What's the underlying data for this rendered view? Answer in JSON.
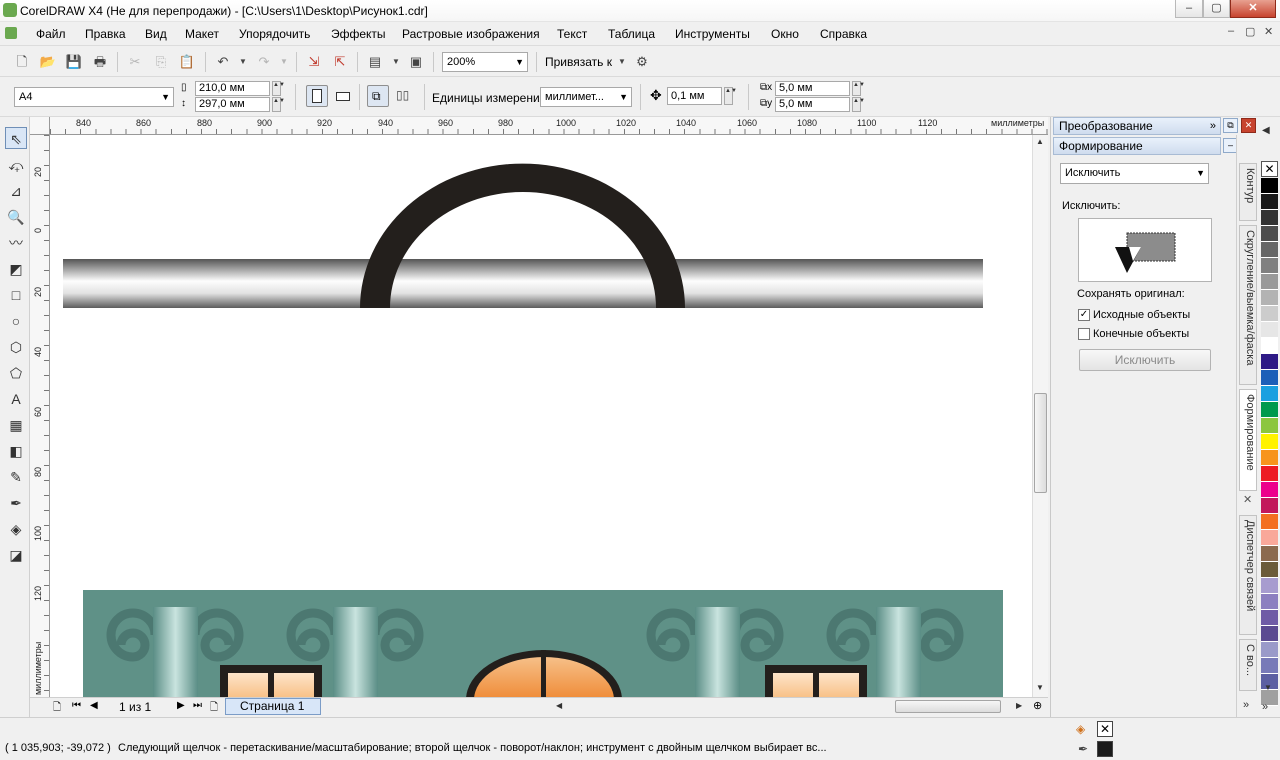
{
  "window": {
    "title": "CorelDRAW X4 (Не для перепродажи) - [C:\\Users\\1\\Desktop\\Рисунок1.cdr]",
    "min_label": "–",
    "max_label": "▢",
    "close_label": "✕"
  },
  "menu": {
    "items": [
      {
        "label": "Файл"
      },
      {
        "label": "Правка"
      },
      {
        "label": "Вид"
      },
      {
        "label": "Макет"
      },
      {
        "label": "Упорядочить"
      },
      {
        "label": "Эффекты"
      },
      {
        "label": "Растровые изображения"
      },
      {
        "label": "Текст"
      },
      {
        "label": "Таблица"
      },
      {
        "label": "Инструменты"
      },
      {
        "label": "Окно"
      },
      {
        "label": "Справка"
      }
    ]
  },
  "toolbar": {
    "zoom_value": "200%",
    "snap_label": "Привязать к"
  },
  "propertybar": {
    "page_size": "A4",
    "width_value": "210,0 мм",
    "height_value": "297,0 мм",
    "units_label": "Единицы измерения:",
    "units_value": "миллимет...",
    "nudge_value": "0,1 мм",
    "dup_x_value": "5,0 мм",
    "dup_y_value": "5,0 мм"
  },
  "rulers": {
    "h_ticks": [
      "840",
      "860",
      "880",
      "900",
      "920",
      "940",
      "960",
      "980",
      "1000",
      "1020",
      "1040",
      "1060",
      "1080",
      "1100",
      "1120"
    ],
    "h_unit": "миллиметры",
    "v_ticks": [
      "20",
      "0",
      "20",
      "40",
      "60",
      "80",
      "100",
      "120"
    ],
    "v_unit": "миллиметры"
  },
  "pagebar": {
    "page_counter": "1 из 1",
    "page_tab": "Страница 1"
  },
  "docker": {
    "transform_title": "Преобразование",
    "shaping_title": "Формирование",
    "mode_value": "Исключить",
    "mode_caption": "Исключить:",
    "keep_original_label": "Сохранять оригинал:",
    "source_objects_label": "Исходные объекты",
    "source_objects_checked": true,
    "target_objects_label": "Конечные объекты",
    "target_objects_checked": false,
    "apply_button": "Исключить",
    "tabs": [
      {
        "label": "Контур"
      },
      {
        "label": "Скругление/выемка/фаска"
      },
      {
        "label": "Формирование"
      },
      {
        "label": "Диспетчер связей"
      },
      {
        "label": "С во..."
      }
    ]
  },
  "palette": {
    "colors": [
      "#000000",
      "#1a1a1a",
      "#333333",
      "#4d4d4d",
      "#666666",
      "#808080",
      "#999999",
      "#b3b3b3",
      "#cccccc",
      "#e6e6e6",
      "#ffffff",
      "#2e1a86",
      "#1c5fb8",
      "#1aa0e0",
      "#009a4d",
      "#8cc63f",
      "#fff200",
      "#f7941d",
      "#ed1c24",
      "#ec008c",
      "#c2185b",
      "#f36f21",
      "#f9a89a",
      "#8b6a4f",
      "#6b5b3a",
      "#a79ccf",
      "#8c7fc0",
      "#6f5ba6",
      "#5b4a91",
      "#9a9ac9",
      "#787ab8",
      "#5c5fa2",
      "#a0a0a0"
    ]
  },
  "statusbar": {
    "coords": "( 1 035,903; -39,072 )",
    "hint": "Следующий щелчок - перетаскивание/масштабирование; второй щелчок - поворот/наклон; инструмент с двойным щелчком выбирает вс..."
  },
  "colors": {
    "arch": "#231f1c",
    "facade": "#5f9187",
    "window_glass": "#f9c99a",
    "dome": "#f29a4c"
  }
}
